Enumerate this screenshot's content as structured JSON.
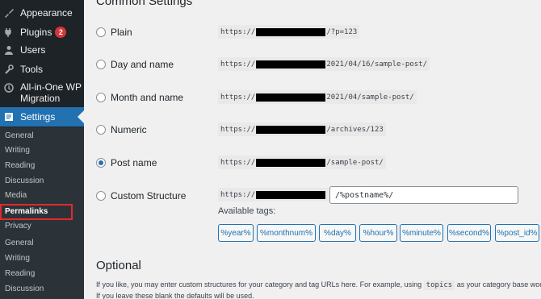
{
  "sidebar": {
    "appearance": "Appearance",
    "plugins": "Plugins",
    "plugins_badge": "2",
    "users": "Users",
    "tools": "Tools",
    "aio_line1": "All-in-One WP",
    "aio_line2": "Migration",
    "settings": "Settings",
    "sub1": [
      "General",
      "Writing",
      "Reading",
      "Discussion",
      "Media",
      "Permalinks",
      "Privacy"
    ],
    "sub2": [
      "General",
      "Writing",
      "Reading",
      "Discussion"
    ]
  },
  "main": {
    "common_title": "Common Settings",
    "options": [
      {
        "label": "Plain",
        "prefix": "https://",
        "suffix": "/?p=123",
        "checked": false
      },
      {
        "label": "Day and name",
        "prefix": "https://",
        "suffix": "2021/04/16/sample-post/",
        "checked": false
      },
      {
        "label": "Month and name",
        "prefix": "https://",
        "suffix": "2021/04/sample-post/",
        "checked": false
      },
      {
        "label": "Numeric",
        "prefix": "https://",
        "suffix": "/archives/123",
        "checked": false
      },
      {
        "label": "Post name",
        "prefix": "https://",
        "suffix": "/sample-post/",
        "checked": true
      },
      {
        "label": "Custom Structure",
        "prefix": "https://",
        "suffix": "",
        "checked": false
      }
    ],
    "custom_value": "/%postname%/",
    "available_tags_label": "Available tags:",
    "tags": [
      "%year%",
      "%monthnum%",
      "%day%",
      "%hour%",
      "%minute%",
      "%second%",
      "%post_id%"
    ],
    "optional_title": "Optional",
    "desc_line1_a": "If you like, you may enter custom structures for your category and tag URLs here. For example, using",
    "desc_code": "topics",
    "desc_line1_b": "as your category base would m",
    "desc_line2": "If you leave these blank the defaults will be used."
  },
  "colors": {
    "accent": "#2271b1",
    "sidebar_bg": "#1d2327",
    "highlight": "#e02a2a"
  }
}
